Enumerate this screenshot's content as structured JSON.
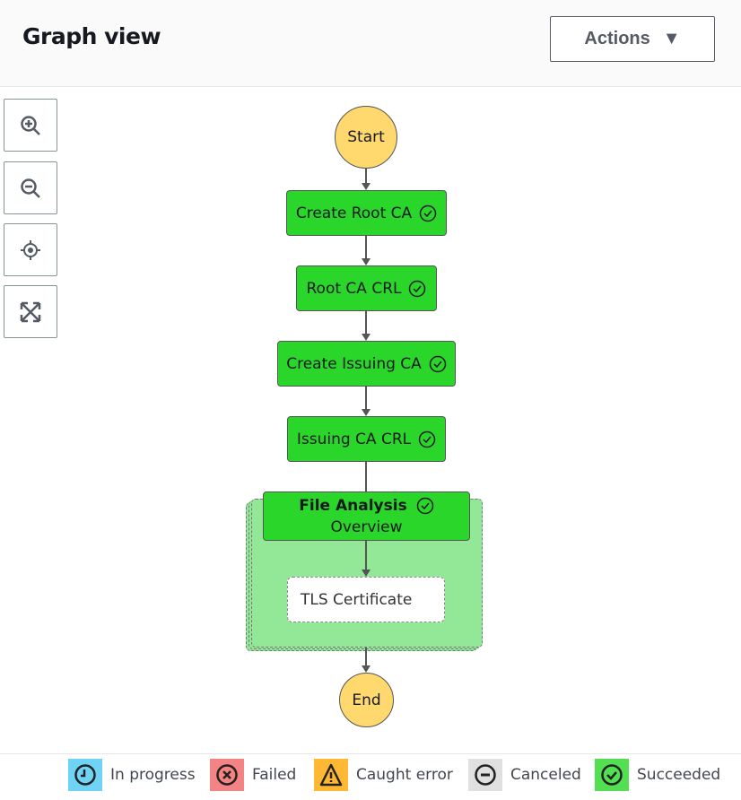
{
  "header": {
    "title": "Graph view",
    "actions_label": "Actions"
  },
  "toolbar": [
    "zoom-in",
    "zoom-out",
    "center",
    "fit"
  ],
  "graph": {
    "start": "Start",
    "end": "End",
    "nodes": [
      {
        "label": "Create Root CA",
        "status": "Succeeded"
      },
      {
        "label": "Root CA CRL",
        "status": "Succeeded"
      },
      {
        "label": "Create Issuing CA",
        "status": "Succeeded"
      },
      {
        "label": "Issuing CA CRL",
        "status": "Succeeded"
      }
    ],
    "map": {
      "title": "File Analysis",
      "subtitle": "Overview",
      "status": "Succeeded",
      "inner": "TLS Certificate"
    }
  },
  "legend": [
    {
      "label": "In progress",
      "color": "#6fd3f5"
    },
    {
      "label": "Failed",
      "color": "#f58383"
    },
    {
      "label": "Caught error",
      "color": "#ffb833"
    },
    {
      "label": "Canceled",
      "color": "#e0e0e0"
    },
    {
      "label": "Succeeded",
      "color": "#52e052"
    }
  ]
}
